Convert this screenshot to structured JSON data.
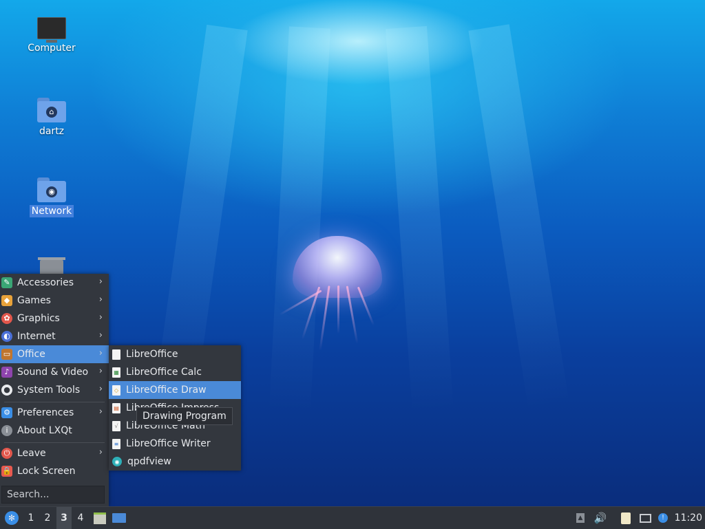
{
  "desktop": {
    "icons": [
      {
        "label": "Computer",
        "icon": "computer-icon"
      },
      {
        "label": "dartz",
        "icon": "home-folder-icon"
      },
      {
        "label": "Network",
        "icon": "network-folder-icon",
        "selected": true
      },
      {
        "label": "",
        "icon": "trash-icon"
      }
    ]
  },
  "menu": {
    "items": [
      {
        "label": "Accessories",
        "icon": "accessories-icon",
        "color": "#3aa675",
        "submenu": true
      },
      {
        "label": "Games",
        "icon": "games-icon",
        "color": "#e8a23a",
        "submenu": true
      },
      {
        "label": "Graphics",
        "icon": "graphics-icon",
        "color": "#e2574c",
        "submenu": true
      },
      {
        "label": "Internet",
        "icon": "internet-icon",
        "color": "#4a6fd8",
        "submenu": true
      },
      {
        "label": "Office",
        "icon": "office-icon",
        "color": "#c0752e",
        "submenu": true,
        "highlighted": true
      },
      {
        "label": "Sound & Video",
        "icon": "sound-video-icon",
        "color": "#8e44ad",
        "submenu": true
      },
      {
        "label": "System Tools",
        "icon": "system-tools-icon",
        "color": "#e8eaed",
        "submenu": true
      },
      {
        "label": "Preferences",
        "icon": "preferences-icon",
        "color": "#3a8ee6",
        "submenu": true
      },
      {
        "label": "About LXQt",
        "icon": "info-icon",
        "color": "#8a8f96",
        "submenu": false
      },
      {
        "label": "Leave",
        "icon": "power-icon",
        "color": "#e2574c",
        "submenu": true
      },
      {
        "label": "Lock Screen",
        "icon": "lock-icon",
        "color": "#e85a4f",
        "submenu": false
      }
    ],
    "search_placeholder": "Search..."
  },
  "office_submenu": {
    "items": [
      {
        "label": "LibreOffice",
        "icon": "libreoffice-icon"
      },
      {
        "label": "LibreOffice Calc",
        "icon": "libreoffice-calc-icon"
      },
      {
        "label": "LibreOffice Draw",
        "icon": "libreoffice-draw-icon",
        "highlighted": true
      },
      {
        "label": "LibreOffice Impress",
        "icon": "libreoffice-impress-icon"
      },
      {
        "label": "LibreOffice Math",
        "icon": "libreoffice-math-icon"
      },
      {
        "label": "LibreOffice Writer",
        "icon": "libreoffice-writer-icon"
      },
      {
        "label": "qpdfview",
        "icon": "qpdfview-icon"
      }
    ]
  },
  "tooltip": "Drawing Program",
  "taskbar": {
    "desktops": [
      "1",
      "2",
      "3",
      "4"
    ],
    "active_desktop": "3",
    "clock": "11:20"
  },
  "colors": {
    "menu_bg": "#33373e",
    "highlight": "#4a8ad8",
    "taskbar_bg": "#2f333a"
  }
}
